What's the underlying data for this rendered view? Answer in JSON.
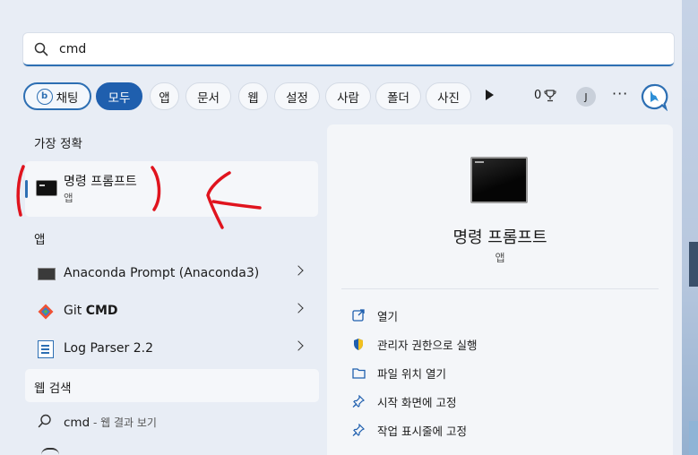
{
  "search": {
    "value": "cmd"
  },
  "filters": {
    "chat": "채팅",
    "all": "모두",
    "apps": "앱",
    "documents": "문서",
    "web": "웹",
    "settings": "설정",
    "people": "사람",
    "folders": "폴더",
    "photos": "사진",
    "points": "0",
    "avatar_initial": "J",
    "more": "···"
  },
  "best_match": {
    "header": "가장 정확",
    "title": "명령 프롬프트",
    "subtitle": "앱"
  },
  "apps": {
    "header": "앱",
    "items": [
      {
        "label": "Anaconda Prompt (Anaconda3)"
      },
      {
        "label_prefix": "Git ",
        "label_bold": "CMD"
      },
      {
        "label": "Log Parser 2.2"
      }
    ]
  },
  "web_search": {
    "header": "웹 검색",
    "query": "cmd",
    "hint": " - 웹 결과 보기"
  },
  "detail": {
    "title": "명령 프롬프트",
    "subtitle": "앱",
    "actions": [
      {
        "label": "열기",
        "icon": "open-icon"
      },
      {
        "label": "관리자 권한으로 실행",
        "icon": "shield-icon"
      },
      {
        "label": "파일 위치 열기",
        "icon": "folder-icon"
      },
      {
        "label": "시작 화면에 고정",
        "icon": "pin-icon"
      },
      {
        "label": "작업 표시줄에 고정",
        "icon": "pin-icon"
      }
    ]
  },
  "colors": {
    "accent": "#1f5fae",
    "annotation": "#e0141e"
  }
}
